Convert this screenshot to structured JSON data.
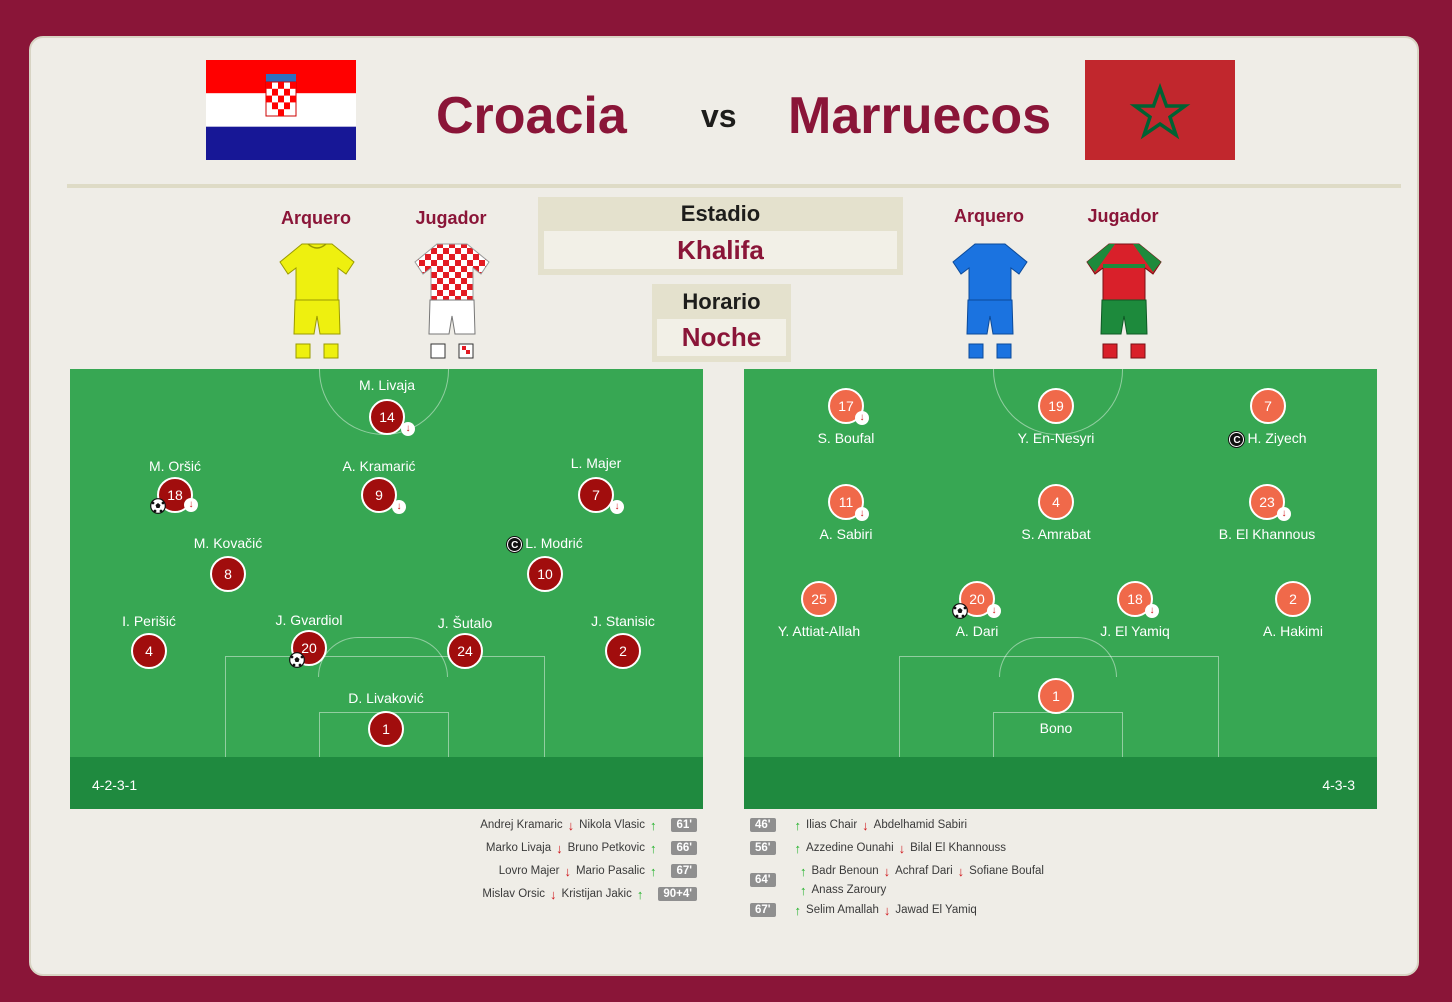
{
  "match": {
    "home_team": "Croacia",
    "vs": "vs",
    "away_team": "Marruecos",
    "stadium_label": "Estadio",
    "stadium_value": "Khalifa",
    "time_label": "Horario",
    "time_value": "Noche"
  },
  "kits": {
    "home": {
      "gk_label": "Arquero",
      "player_label": "Jugador"
    },
    "away": {
      "gk_label": "Arquero",
      "player_label": "Jugador"
    }
  },
  "home_lineup": {
    "formation": "4-2-3-1",
    "players": [
      {
        "name": "M. Livaja",
        "number": "14",
        "sub_out": true
      },
      {
        "name": "M. Oršić",
        "number": "18",
        "sub_out": true,
        "goal": true
      },
      {
        "name": "A. Kramarić",
        "number": "9",
        "sub_out": true
      },
      {
        "name": "L. Majer",
        "number": "7",
        "sub_out": true
      },
      {
        "name": "M. Kovačić",
        "number": "8"
      },
      {
        "name": "L. Modrić",
        "number": "10",
        "captain": true
      },
      {
        "name": "I. Perišić",
        "number": "4"
      },
      {
        "name": "J. Gvardiol",
        "number": "20",
        "goal": true
      },
      {
        "name": "J. Šutalo",
        "number": "24"
      },
      {
        "name": "J. Stanisic",
        "number": "2"
      },
      {
        "name": "D. Livaković",
        "number": "1"
      }
    ]
  },
  "away_lineup": {
    "formation": "4-3-3",
    "players": [
      {
        "name": "S. Boufal",
        "number": "17",
        "sub_out": true
      },
      {
        "name": "Y. En-Nesyri",
        "number": "19"
      },
      {
        "name": "H. Ziyech",
        "number": "7",
        "captain": true
      },
      {
        "name": "A. Sabiri",
        "number": "11",
        "sub_out": true
      },
      {
        "name": "S. Amrabat",
        "number": "4"
      },
      {
        "name": "B. El Khannous",
        "number": "23",
        "sub_out": true
      },
      {
        "name": "Y. Attiat-Allah",
        "number": "25"
      },
      {
        "name": "A. Dari",
        "number": "20",
        "sub_out": true,
        "goal": true
      },
      {
        "name": "J. El Yamiq",
        "number": "18",
        "sub_out": true
      },
      {
        "name": "A. Hakimi",
        "number": "2"
      },
      {
        "name": "Bono",
        "number": "1"
      }
    ]
  },
  "home_subs": [
    {
      "out": "Andrej Kramaric",
      "in": "Nikola Vlasic",
      "minute": "61'"
    },
    {
      "out": "Marko Livaja",
      "in": "Bruno Petkovic",
      "minute": "66'"
    },
    {
      "out": "Lovro Majer",
      "in": "Mario Pasalic",
      "minute": "67'"
    },
    {
      "out": "Mislav Orsic",
      "in": "Kristijan Jakic",
      "minute": "90+4'"
    }
  ],
  "away_subs": [
    {
      "minute": "46'",
      "in": [
        "Ilias Chair"
      ],
      "out": [
        "Abdelhamid Sabiri"
      ]
    },
    {
      "minute": "56'",
      "in": [
        "Azzedine Ounahi"
      ],
      "out": [
        "Bilal El Khannouss"
      ]
    },
    {
      "minute": "64'",
      "in": [
        "Badr Benoun",
        "Anass Zaroury"
      ],
      "out": [
        "Achraf Dari",
        "Sofiane Boufal"
      ]
    },
    {
      "minute": "67'",
      "in": [
        "Selim Amallah"
      ],
      "out": [
        "Jawad El Yamiq"
      ]
    }
  ],
  "colors": {
    "background": "#8a1538",
    "card": "#efede7",
    "pitch": "#37a753",
    "pitch_footer": "#1f8a3f",
    "home_player": "#a10d0d",
    "away_player": "#f0694a",
    "accent_text": "#8a1538"
  },
  "icons": [
    "croatia-flag",
    "morocco-flag",
    "goal-ball-icon",
    "captain-icon",
    "sub-out-arrow-icon",
    "sub-in-arrow-icon",
    "kit-shirt-icon"
  ]
}
